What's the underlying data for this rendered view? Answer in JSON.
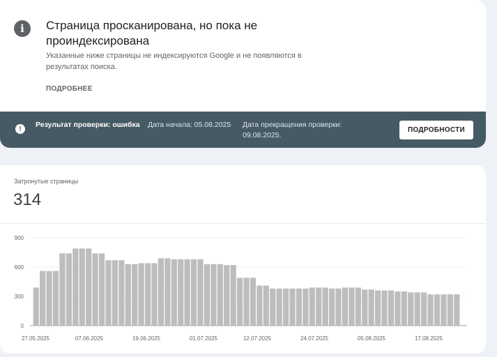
{
  "status_card": {
    "icon": "info-icon",
    "title": "Страница просканирована, но пока не проиндексирована",
    "subtitle": "Указанные ниже страницы не индексируются Google и не появляются в результатах поиска.",
    "more_link": "ПОДРОБНЕЕ"
  },
  "validation": {
    "icon": "alert-icon",
    "result_label": "Результат проверки: ошибка",
    "start_date": "Дата начала: 05.08.2025",
    "end_date": "Дата прекращения проверки: 09.08.2025.",
    "details_button": "ПОДРОБНОСТИ"
  },
  "affected": {
    "label": "Затронутые страницы",
    "value": "314"
  },
  "chart_data": {
    "type": "bar",
    "ylim": [
      0,
      900
    ],
    "yticks": [
      "900",
      "600",
      "300",
      "0"
    ],
    "xticks": [
      "27.05.2025",
      "07.06.2025",
      "19.06.2025",
      "01.07.2025",
      "12.07.2025",
      "24.07.2025",
      "05.08.2025",
      "17.08.2025"
    ],
    "values": [
      390,
      560,
      560,
      560,
      740,
      740,
      790,
      790,
      790,
      740,
      740,
      670,
      670,
      670,
      630,
      630,
      640,
      640,
      640,
      690,
      690,
      680,
      680,
      680,
      680,
      680,
      630,
      630,
      630,
      620,
      620,
      490,
      490,
      490,
      410,
      410,
      380,
      380,
      380,
      380,
      380,
      380,
      390,
      390,
      390,
      380,
      380,
      390,
      390,
      390,
      370,
      370,
      360,
      360,
      360,
      350,
      350,
      340,
      340,
      340,
      320,
      320,
      320,
      320,
      320
    ],
    "bar_color": "#bdbdbd",
    "grid": true
  }
}
